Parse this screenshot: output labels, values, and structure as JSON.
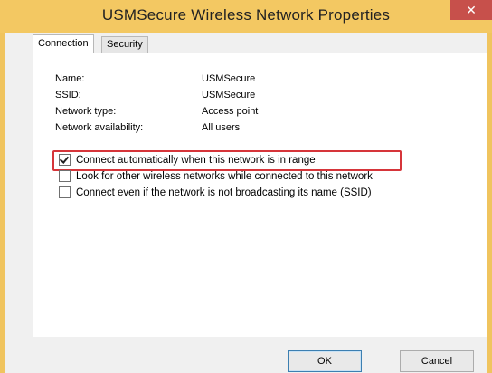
{
  "window": {
    "title": "USMSecure Wireless Network Properties",
    "close_glyph": "✕"
  },
  "tabs": [
    {
      "label": "Connection",
      "active": true
    },
    {
      "label": "Security",
      "active": false
    }
  ],
  "info": {
    "name_label": "Name:",
    "name_value": "USMSecure",
    "ssid_label": "SSID:",
    "ssid_value": "USMSecure",
    "type_label": "Network type:",
    "type_value": "Access point",
    "availability_label": "Network availability:",
    "availability_value": "All users"
  },
  "options": [
    {
      "label": "Connect automatically when this network is in range",
      "checked": true
    },
    {
      "label": "Look for other wireless networks while connected to this network",
      "checked": false
    },
    {
      "label": "Connect even if the network is not broadcasting its name (SSID)",
      "checked": false
    }
  ],
  "buttons": {
    "ok_label": "OK",
    "cancel_label": "Cancel"
  },
  "colors": {
    "window_frame": "#f0c45e",
    "close_button": "#c7504b",
    "highlight_border": "#d6353a"
  }
}
